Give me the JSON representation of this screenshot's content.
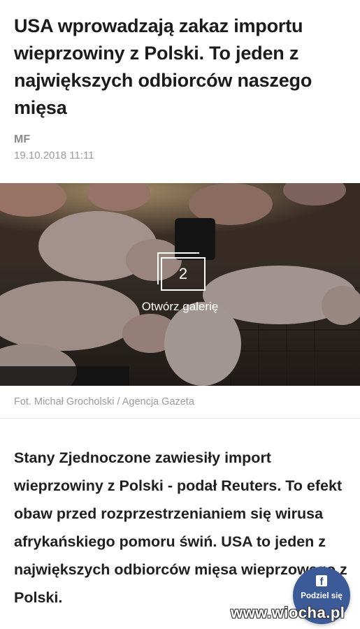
{
  "article": {
    "title": "USA wprowadzają zakaz importu wieprzowiny z Polski. To jeden z największych odbiorców naszego mięsa",
    "author": "MF",
    "date": "19.10.2018 11:11"
  },
  "gallery": {
    "count": "2",
    "label": "Otwórz galerię",
    "icon": "gallery-stack-icon"
  },
  "photo_credit": "Fot. Michał Grocholski / Agencja Gazeta",
  "lead": "Stany Zjednoczone zawiesiły import wieprzowiny z Polski - podał Reuters. To efekt obaw przed rozprzestrzenianiem się wirusa afrykańskiego pomoru świń. USA to jeden z największych odbiorców mięsa wieprzowego z Polski.",
  "share": {
    "label": "Podziel się",
    "icon": "facebook-icon",
    "icon_glyph": "f",
    "color": "#3d5a98"
  },
  "watermark": "www.wiocha.pl"
}
